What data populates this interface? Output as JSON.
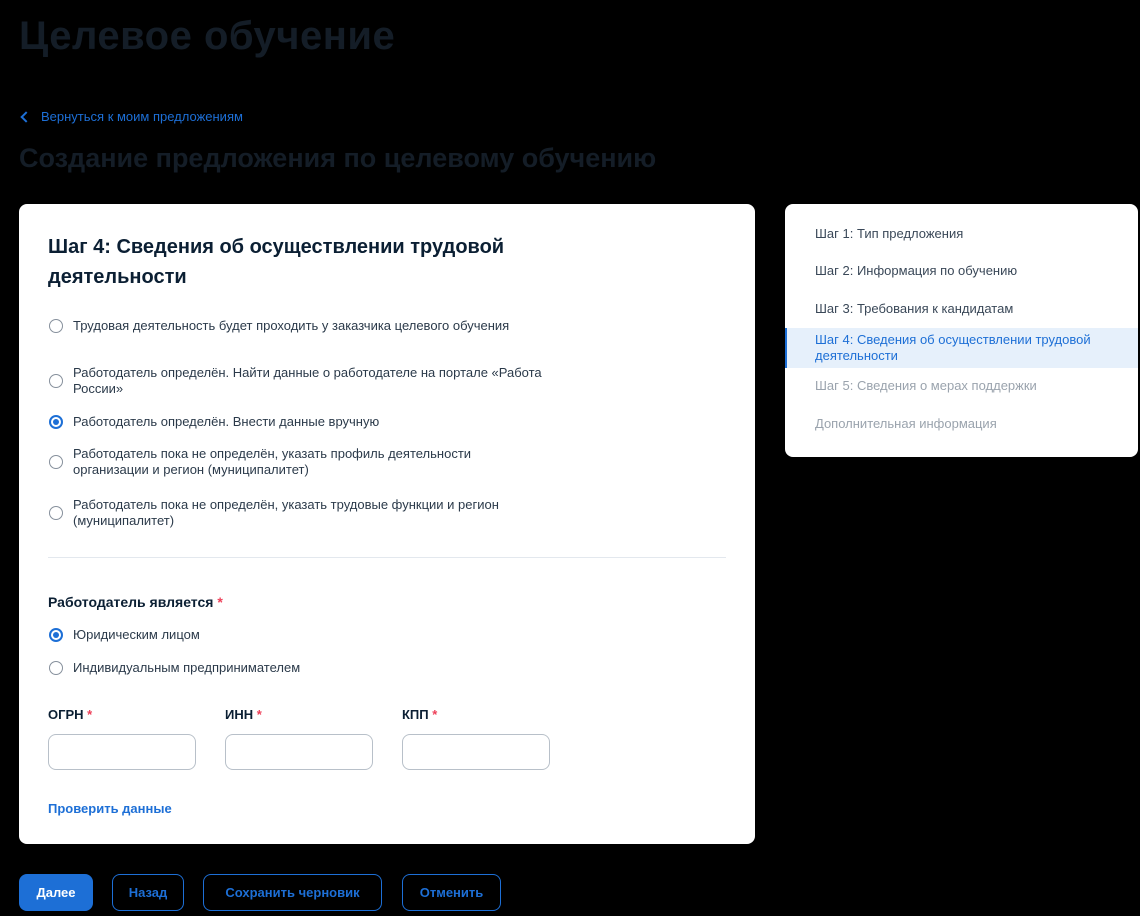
{
  "page": {
    "title": "Целевое обучение",
    "back_link": "Вернуться к моим предложениям",
    "subtitle": "Создание предложения по целевому обучению"
  },
  "form": {
    "step_title": "Шаг 4: Сведения об осуществлении трудовой деятельности",
    "options": [
      {
        "label": "Трудовая деятельность будет проходить у заказчика целевого обучения",
        "checked": false
      },
      {
        "label": "Работодатель определён. Найти данные о работодателе на портале «Работа России»",
        "checked": false
      },
      {
        "label": "Работодатель определён. Внести данные вручную",
        "checked": true
      },
      {
        "label": "Работодатель пока не определён, указать профиль деятельности организации и регион (муниципалитет)",
        "checked": false
      },
      {
        "label": "Работодатель пока не определён, указать трудовые функции и регион (муниципалитет)",
        "checked": false
      }
    ],
    "employer_type_label": "Работодатель является",
    "required_mark": "*",
    "employer_types": [
      {
        "label": "Юридическим лицом",
        "checked": true
      },
      {
        "label": "Индивидуальным предпринимателем",
        "checked": false
      }
    ],
    "fields": {
      "ogrn": {
        "label": "ОГРН",
        "value": ""
      },
      "inn": {
        "label": "ИНН",
        "value": ""
      },
      "kpp": {
        "label": "КПП",
        "value": ""
      }
    },
    "check_link": "Проверить данные"
  },
  "steps": [
    {
      "label": "Шаг 1: Тип предложения",
      "state": "done"
    },
    {
      "label": "Шаг 2: Информация по обучению",
      "state": "done"
    },
    {
      "label": "Шаг 3: Требования к кандидатам",
      "state": "done"
    },
    {
      "label": "Шаг 4: Сведения об осуществлении трудовой деятельности",
      "state": "active"
    },
    {
      "label": "Шаг 5: Сведения о мерах поддержки",
      "state": "disabled"
    },
    {
      "label": "Дополнительная информация",
      "state": "disabled"
    }
  ],
  "footer": {
    "next": "Далее",
    "back": "Назад",
    "save_draft": "Сохранить черновик",
    "cancel": "Отменить"
  },
  "colors": {
    "accent": "#1d6fd6",
    "required": "#ee3f58",
    "background": "#000000"
  }
}
